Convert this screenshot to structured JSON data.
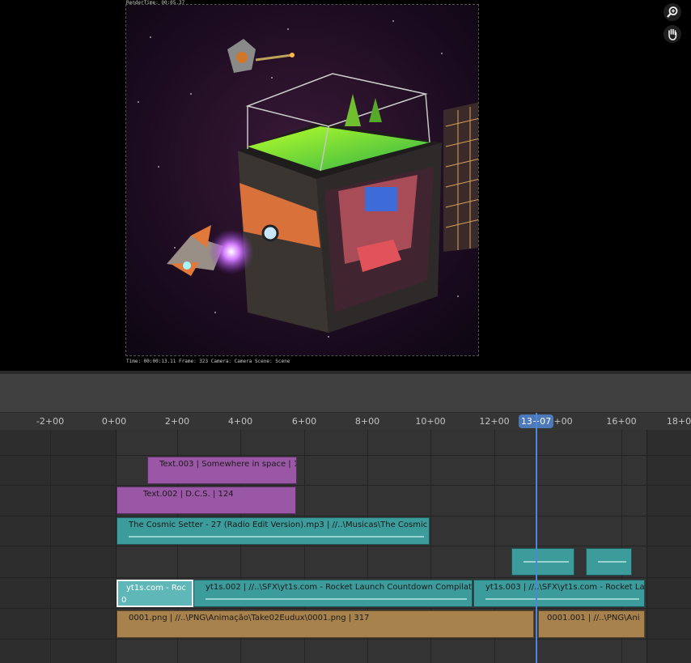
{
  "preview": {
    "render_time": "RenderTime: 00:05.37",
    "footer": "Time: 00:00:13.11  Frame: 323  Camera: Camera  Scene: Scene",
    "zoom_tool": "zoom-in-icon",
    "pan_tool": "hand-icon"
  },
  "timeline": {
    "ticks": [
      "-2+00",
      "0+00",
      "2+00",
      "4+00",
      "6+00",
      "8+00",
      "10+00",
      "12+00",
      "+00",
      "16+00",
      "18+0"
    ],
    "current_frame": "13+07"
  },
  "strips": {
    "text003": "Text.003 | Somewhere in space | 1",
    "text002": "Text.002 | D.C.S. | 124",
    "music": "The Cosmic Setter - 27 (Radio Edit Version).mp3 | //..\\Musicas\\The Cosmic Set",
    "yt_selected": "yt1s.com - Roc",
    "yt_selected_sub": "0",
    "yt002": "yt1s.002 | //..\\SFX\\yt1s.com - Rocket Launch Countdown Compilatio",
    "yt003": "yt1s.003 | //..\\SFX\\yt1s.com - Rocket La",
    "png0001": "0001.png | //..\\PNG\\Animação\\Take02Eudux\\0001.png | 317",
    "png0001_001": "0001.001 | //..\\PNG\\Ani"
  },
  "colors": {
    "text_strip": "#9a57a6",
    "sound_strip": "#3c9b9b",
    "image_strip": "#a8824d",
    "playhead": "#4f86d9"
  }
}
